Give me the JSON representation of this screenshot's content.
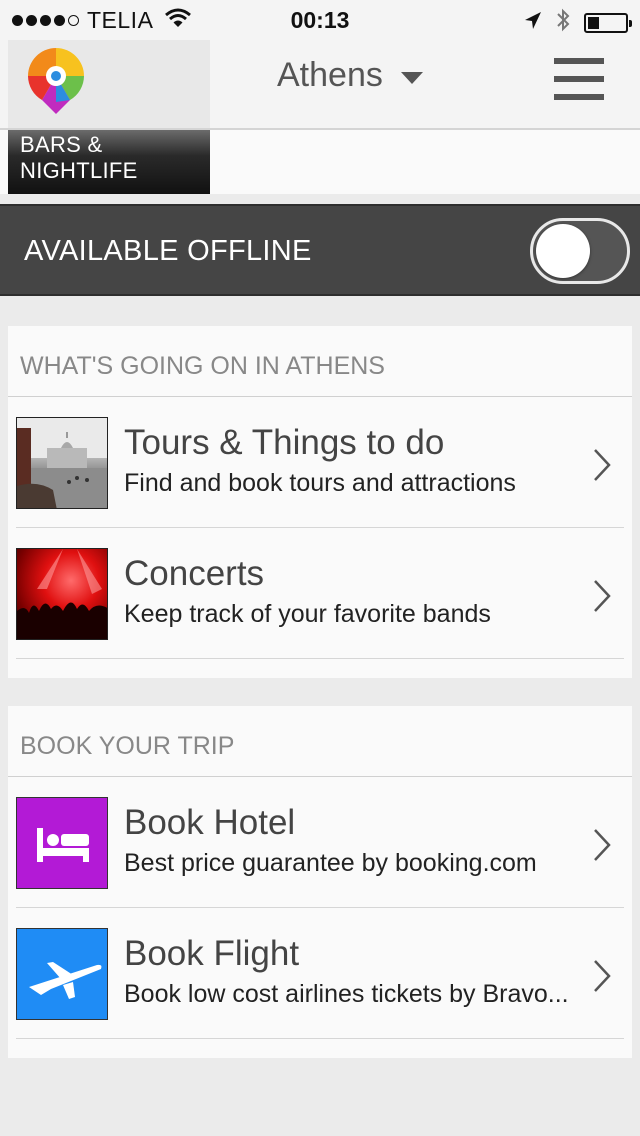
{
  "status": {
    "carrier": "TELIA",
    "time": "00:13",
    "battery_level": 0.3
  },
  "header": {
    "city": "Athens"
  },
  "category": {
    "label": "BARS & NIGHTLIFE"
  },
  "offline": {
    "label": "AVAILABLE OFFLINE",
    "enabled": false
  },
  "going_on": {
    "title": "WHAT'S GOING ON IN ATHENS",
    "items": [
      {
        "title": "Tours & Things to do",
        "subtitle": "Find and book tours and attractions",
        "icon": "tours-thumbnail"
      },
      {
        "title": "Concerts",
        "subtitle": "Keep track of your favorite bands",
        "icon": "concerts-thumbnail"
      }
    ]
  },
  "book_trip": {
    "title": "BOOK YOUR TRIP",
    "items": [
      {
        "title": "Book Hotel",
        "subtitle": "Best price guarantee by booking.com",
        "icon": "bed-icon"
      },
      {
        "title": "Book Flight",
        "subtitle": "Book low cost airlines tickets by Bravo...",
        "icon": "airplane-icon"
      }
    ]
  },
  "colors": {
    "hotel_tile": "#b31ad6",
    "flight_tile": "#1f8cf5",
    "offline_bar": "#454545"
  }
}
